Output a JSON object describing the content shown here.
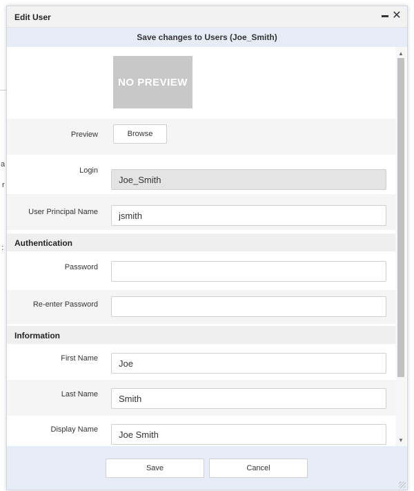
{
  "dialog": {
    "title": "Edit User",
    "header": "Save changes to Users (Joe_Smith)"
  },
  "preview": {
    "placeholder": "NO PREVIEW",
    "label": "Preview",
    "browse_label": "Browse"
  },
  "fields": {
    "login": {
      "label": "Login",
      "value": "Joe_Smith"
    },
    "upn": {
      "label": "User Principal Name",
      "value": "jsmith"
    },
    "password": {
      "label": "Password",
      "value": ""
    },
    "reenter_password": {
      "label": "Re-enter Password",
      "value": ""
    },
    "first_name": {
      "label": "First Name",
      "value": "Joe"
    },
    "last_name": {
      "label": "Last Name",
      "value": "Smith"
    },
    "display_name": {
      "label": "Display Name",
      "value": "Joe Smith"
    }
  },
  "sections": {
    "authentication": "Authentication",
    "information": "Information"
  },
  "footer": {
    "save_label": "Save",
    "cancel_label": "Cancel"
  },
  "icons": {
    "minimize": "minimize-icon",
    "close": "close-icon",
    "scroll_up": "scroll-up-icon",
    "scroll_down": "scroll-down-icon"
  },
  "colors": {
    "header_band": "#e6edf7",
    "section_head": "#efefef",
    "readonly_input": "#e4e4e4",
    "preview_box": "#c8c8c8"
  }
}
